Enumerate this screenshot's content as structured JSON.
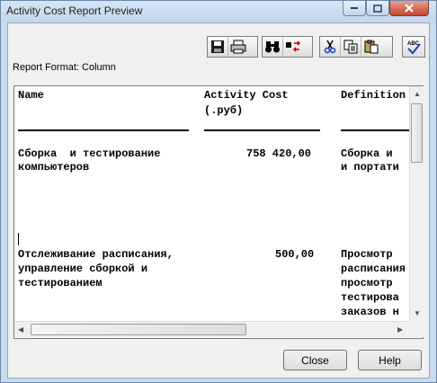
{
  "window": {
    "title": "Activity Cost Report Preview"
  },
  "report_format": {
    "label": "Report Format: Column"
  },
  "report": {
    "columns": {
      "name": "Name",
      "cost_line1": "Activity Cost",
      "cost_line2": "(.руб)",
      "definition": "Definition"
    },
    "rows": [
      {
        "name_lines": [
          "Сборка  и тестирование",
          "компьютеров"
        ],
        "cost": "758 420,00",
        "definition_lines": [
          "Сборка и",
          "и портати"
        ]
      },
      {
        "name_lines": [
          "Отслеживание расписания,",
          "управление сборкой и",
          "тестированием"
        ],
        "cost": "500,00",
        "definition_lines": [
          "Просмотр ",
          "расписания",
          "просмотр ",
          "тестирова",
          "заказов н"
        ]
      }
    ]
  },
  "buttons": {
    "close": "Close",
    "help": "Help"
  },
  "icons": [
    "save-icon",
    "print-icon",
    "find-icon",
    "replace-icon",
    "cut-icon",
    "copy-icon",
    "paste-icon",
    "spellcheck-icon"
  ]
}
